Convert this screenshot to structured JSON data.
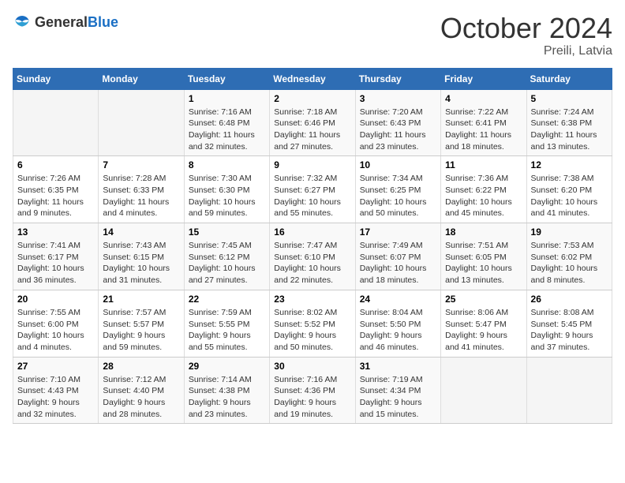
{
  "logo": {
    "general": "General",
    "blue": "Blue"
  },
  "title": "October 2024",
  "location": "Preili, Latvia",
  "days_header": [
    "Sunday",
    "Monday",
    "Tuesday",
    "Wednesday",
    "Thursday",
    "Friday",
    "Saturday"
  ],
  "weeks": [
    [
      {
        "day": "",
        "sunrise": "",
        "sunset": "",
        "daylight": ""
      },
      {
        "day": "",
        "sunrise": "",
        "sunset": "",
        "daylight": ""
      },
      {
        "day": "1",
        "sunrise": "Sunrise: 7:16 AM",
        "sunset": "Sunset: 6:48 PM",
        "daylight": "Daylight: 11 hours and 32 minutes."
      },
      {
        "day": "2",
        "sunrise": "Sunrise: 7:18 AM",
        "sunset": "Sunset: 6:46 PM",
        "daylight": "Daylight: 11 hours and 27 minutes."
      },
      {
        "day": "3",
        "sunrise": "Sunrise: 7:20 AM",
        "sunset": "Sunset: 6:43 PM",
        "daylight": "Daylight: 11 hours and 23 minutes."
      },
      {
        "day": "4",
        "sunrise": "Sunrise: 7:22 AM",
        "sunset": "Sunset: 6:41 PM",
        "daylight": "Daylight: 11 hours and 18 minutes."
      },
      {
        "day": "5",
        "sunrise": "Sunrise: 7:24 AM",
        "sunset": "Sunset: 6:38 PM",
        "daylight": "Daylight: 11 hours and 13 minutes."
      }
    ],
    [
      {
        "day": "6",
        "sunrise": "Sunrise: 7:26 AM",
        "sunset": "Sunset: 6:35 PM",
        "daylight": "Daylight: 11 hours and 9 minutes."
      },
      {
        "day": "7",
        "sunrise": "Sunrise: 7:28 AM",
        "sunset": "Sunset: 6:33 PM",
        "daylight": "Daylight: 11 hours and 4 minutes."
      },
      {
        "day": "8",
        "sunrise": "Sunrise: 7:30 AM",
        "sunset": "Sunset: 6:30 PM",
        "daylight": "Daylight: 10 hours and 59 minutes."
      },
      {
        "day": "9",
        "sunrise": "Sunrise: 7:32 AM",
        "sunset": "Sunset: 6:27 PM",
        "daylight": "Daylight: 10 hours and 55 minutes."
      },
      {
        "day": "10",
        "sunrise": "Sunrise: 7:34 AM",
        "sunset": "Sunset: 6:25 PM",
        "daylight": "Daylight: 10 hours and 50 minutes."
      },
      {
        "day": "11",
        "sunrise": "Sunrise: 7:36 AM",
        "sunset": "Sunset: 6:22 PM",
        "daylight": "Daylight: 10 hours and 45 minutes."
      },
      {
        "day": "12",
        "sunrise": "Sunrise: 7:38 AM",
        "sunset": "Sunset: 6:20 PM",
        "daylight": "Daylight: 10 hours and 41 minutes."
      }
    ],
    [
      {
        "day": "13",
        "sunrise": "Sunrise: 7:41 AM",
        "sunset": "Sunset: 6:17 PM",
        "daylight": "Daylight: 10 hours and 36 minutes."
      },
      {
        "day": "14",
        "sunrise": "Sunrise: 7:43 AM",
        "sunset": "Sunset: 6:15 PM",
        "daylight": "Daylight: 10 hours and 31 minutes."
      },
      {
        "day": "15",
        "sunrise": "Sunrise: 7:45 AM",
        "sunset": "Sunset: 6:12 PM",
        "daylight": "Daylight: 10 hours and 27 minutes."
      },
      {
        "day": "16",
        "sunrise": "Sunrise: 7:47 AM",
        "sunset": "Sunset: 6:10 PM",
        "daylight": "Daylight: 10 hours and 22 minutes."
      },
      {
        "day": "17",
        "sunrise": "Sunrise: 7:49 AM",
        "sunset": "Sunset: 6:07 PM",
        "daylight": "Daylight: 10 hours and 18 minutes."
      },
      {
        "day": "18",
        "sunrise": "Sunrise: 7:51 AM",
        "sunset": "Sunset: 6:05 PM",
        "daylight": "Daylight: 10 hours and 13 minutes."
      },
      {
        "day": "19",
        "sunrise": "Sunrise: 7:53 AM",
        "sunset": "Sunset: 6:02 PM",
        "daylight": "Daylight: 10 hours and 8 minutes."
      }
    ],
    [
      {
        "day": "20",
        "sunrise": "Sunrise: 7:55 AM",
        "sunset": "Sunset: 6:00 PM",
        "daylight": "Daylight: 10 hours and 4 minutes."
      },
      {
        "day": "21",
        "sunrise": "Sunrise: 7:57 AM",
        "sunset": "Sunset: 5:57 PM",
        "daylight": "Daylight: 9 hours and 59 minutes."
      },
      {
        "day": "22",
        "sunrise": "Sunrise: 7:59 AM",
        "sunset": "Sunset: 5:55 PM",
        "daylight": "Daylight: 9 hours and 55 minutes."
      },
      {
        "day": "23",
        "sunrise": "Sunrise: 8:02 AM",
        "sunset": "Sunset: 5:52 PM",
        "daylight": "Daylight: 9 hours and 50 minutes."
      },
      {
        "day": "24",
        "sunrise": "Sunrise: 8:04 AM",
        "sunset": "Sunset: 5:50 PM",
        "daylight": "Daylight: 9 hours and 46 minutes."
      },
      {
        "day": "25",
        "sunrise": "Sunrise: 8:06 AM",
        "sunset": "Sunset: 5:47 PM",
        "daylight": "Daylight: 9 hours and 41 minutes."
      },
      {
        "day": "26",
        "sunrise": "Sunrise: 8:08 AM",
        "sunset": "Sunset: 5:45 PM",
        "daylight": "Daylight: 9 hours and 37 minutes."
      }
    ],
    [
      {
        "day": "27",
        "sunrise": "Sunrise: 7:10 AM",
        "sunset": "Sunset: 4:43 PM",
        "daylight": "Daylight: 9 hours and 32 minutes."
      },
      {
        "day": "28",
        "sunrise": "Sunrise: 7:12 AM",
        "sunset": "Sunset: 4:40 PM",
        "daylight": "Daylight: 9 hours and 28 minutes."
      },
      {
        "day": "29",
        "sunrise": "Sunrise: 7:14 AM",
        "sunset": "Sunset: 4:38 PM",
        "daylight": "Daylight: 9 hours and 23 minutes."
      },
      {
        "day": "30",
        "sunrise": "Sunrise: 7:16 AM",
        "sunset": "Sunset: 4:36 PM",
        "daylight": "Daylight: 9 hours and 19 minutes."
      },
      {
        "day": "31",
        "sunrise": "Sunrise: 7:19 AM",
        "sunset": "Sunset: 4:34 PM",
        "daylight": "Daylight: 9 hours and 15 minutes."
      },
      {
        "day": "",
        "sunrise": "",
        "sunset": "",
        "daylight": ""
      },
      {
        "day": "",
        "sunrise": "",
        "sunset": "",
        "daylight": ""
      }
    ]
  ]
}
